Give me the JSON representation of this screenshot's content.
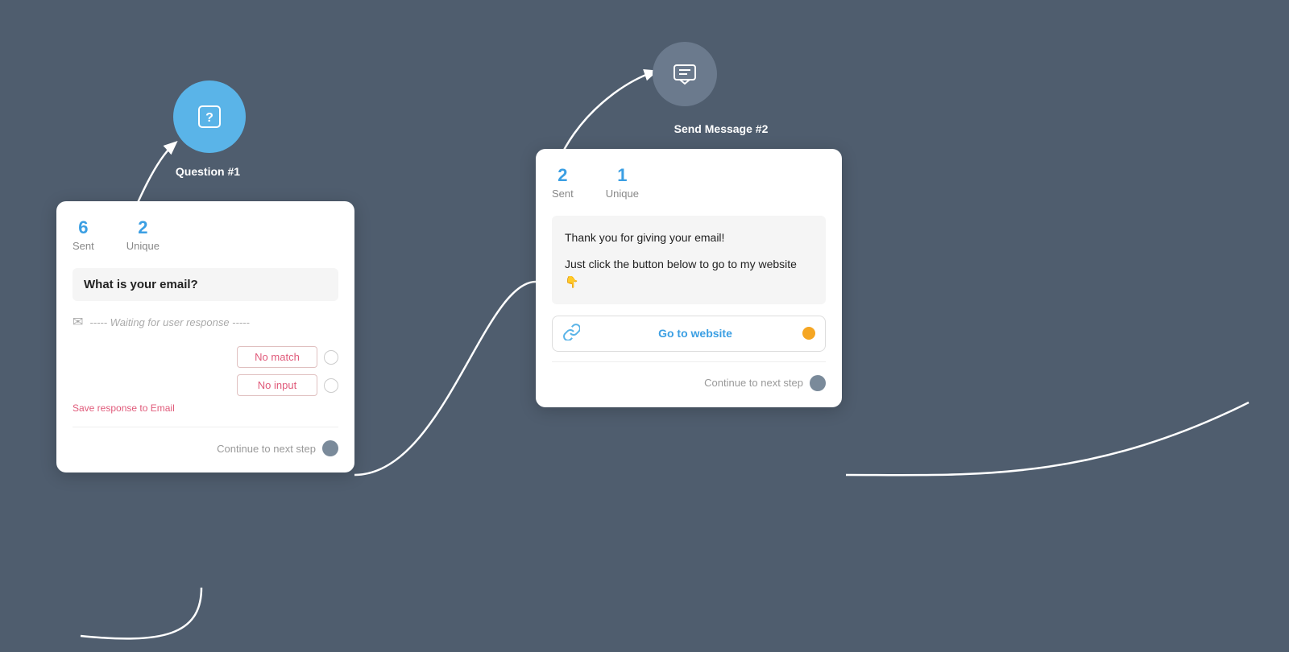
{
  "nodes": {
    "question1": {
      "label": "Question #1",
      "icon": "question-mark"
    },
    "sendMessage2": {
      "label": "Send Message #2",
      "icon": "message"
    }
  },
  "card_q1": {
    "sent_count": "6",
    "sent_label": "Sent",
    "unique_count": "2",
    "unique_label": "Unique",
    "question_text": "What is your email?",
    "waiting_text": "----- Waiting for user response -----",
    "option1_label": "No match",
    "option2_label": "No input",
    "save_response_text": "Save response to",
    "save_response_var": "Email",
    "continue_label": "Continue to next step"
  },
  "card_sm2": {
    "sent_count": "2",
    "sent_label": "Sent",
    "unique_count": "1",
    "unique_label": "Unique",
    "message_line1": "Thank you for giving your email!",
    "message_line2": "Just click the button below to go to my website 👇",
    "link_button_text": "Go to website",
    "continue_label": "Continue to next step"
  }
}
